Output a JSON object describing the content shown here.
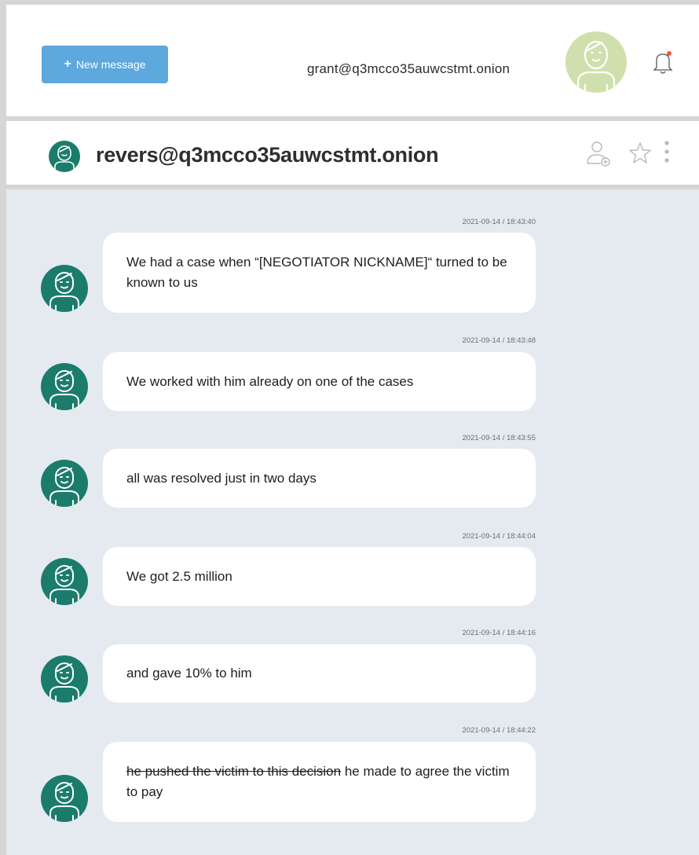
{
  "topbar": {
    "new_message_plus": "+",
    "new_message_label": "New message",
    "user_email": "grant@q3mcco35auwcstmt.onion",
    "notification_dot_color": "#ef5a3c"
  },
  "chat": {
    "peer_name": "revers@q3mcco35auwcstmt.onion",
    "messages": [
      {
        "timestamp": "2021-09-14 / 18:43:40",
        "text": "We had a case when “[NEGOTIATOR NICKNAME]“ turned to be known to us",
        "struck": ""
      },
      {
        "timestamp": "2021-09-14 / 18:43:48",
        "text": "We worked with him already on one of the cases",
        "struck": ""
      },
      {
        "timestamp": "2021-09-14 / 18:43:55",
        "text": "all was resolved just in two days",
        "struck": ""
      },
      {
        "timestamp": "2021-09-14 / 18:44:04",
        "text": "We got 2.5 million",
        "struck": ""
      },
      {
        "timestamp": "2021-09-14 / 18:44:16",
        "text": "and gave 10% to him",
        "struck": ""
      },
      {
        "timestamp": "2021-09-14 / 18:44:22",
        "text": " he made to agree the victim to pay",
        "struck": "he pushed the victim to this decision"
      }
    ]
  },
  "icons": {
    "bell": "bell-icon",
    "add_contact": "add-contact-icon",
    "star": "star-icon",
    "more": "more-vertical-icon"
  },
  "colors": {
    "accent_button": "#5da8dc",
    "avatar_teal": "#1b7c6c",
    "user_avatar_bg": "#cfe0ae",
    "chat_bg": "#e5eaf1"
  }
}
